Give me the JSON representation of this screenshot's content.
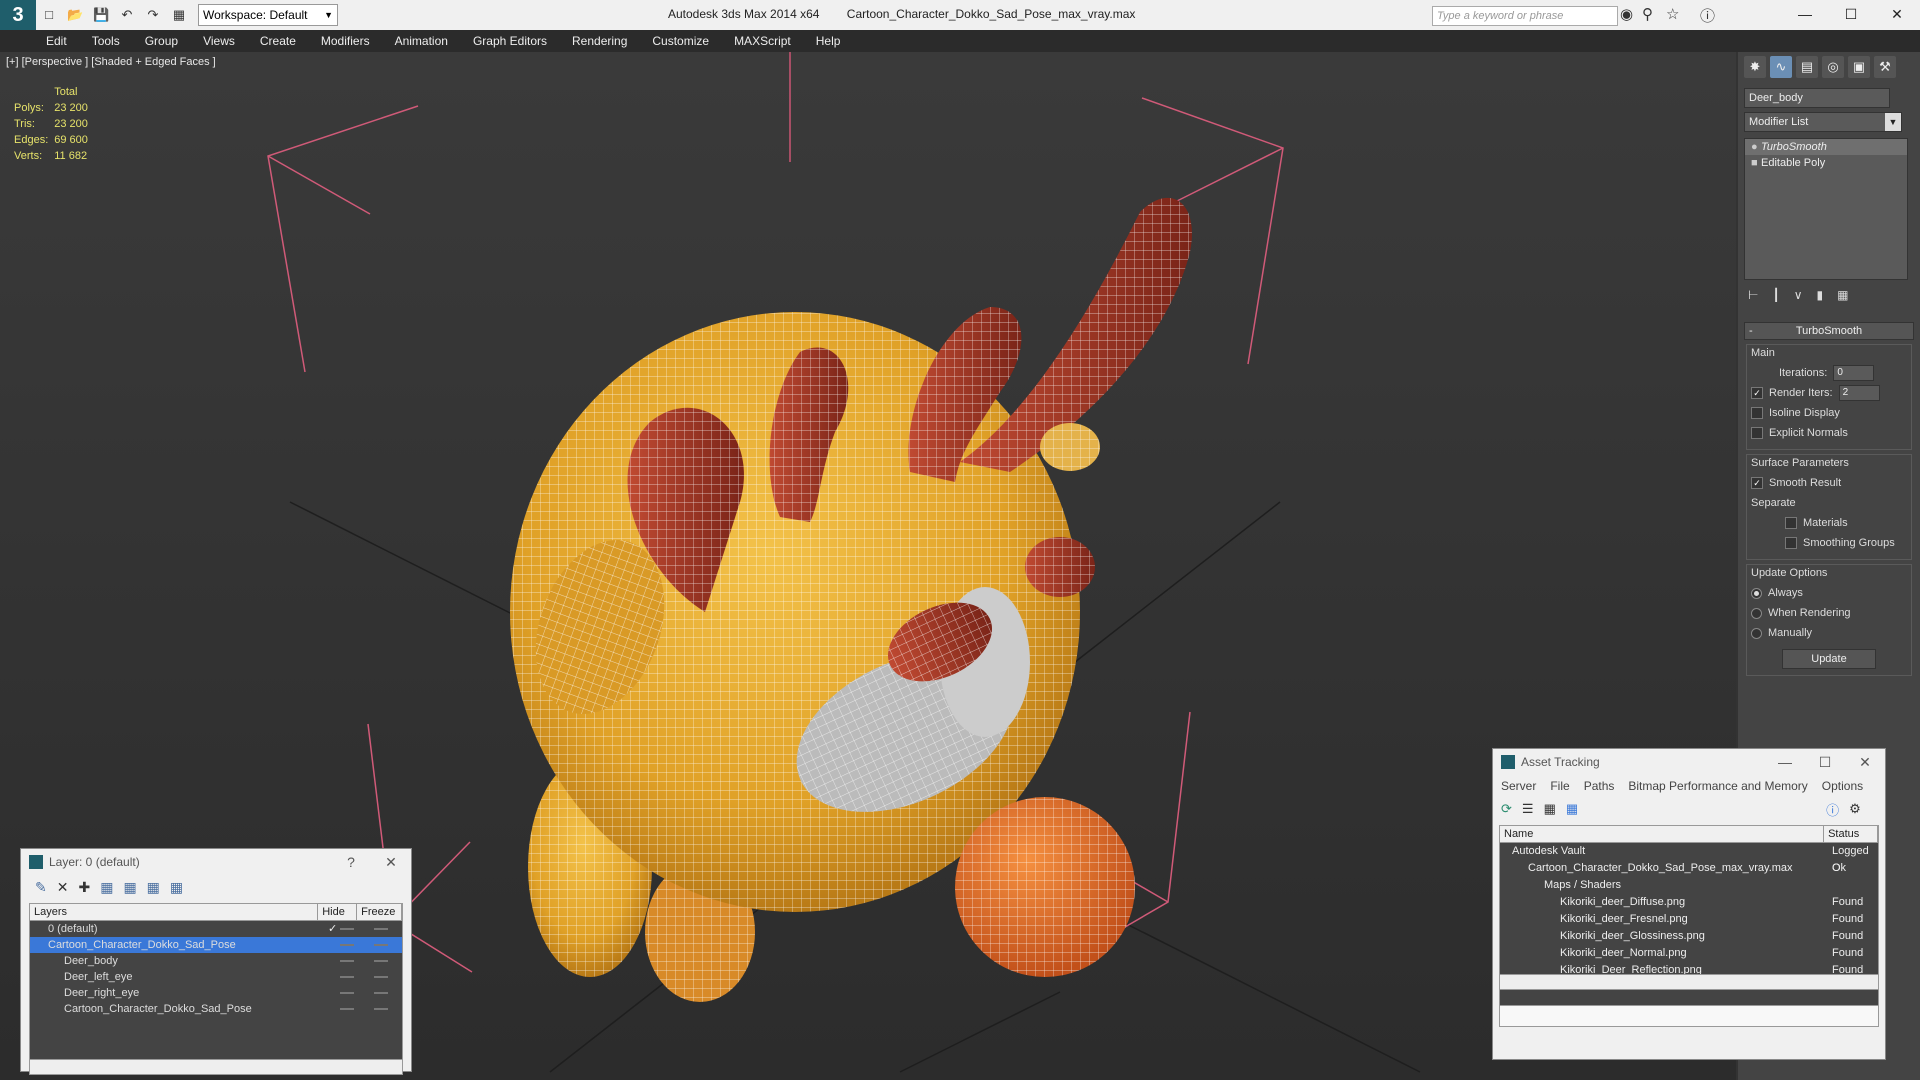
{
  "app": {
    "title": "Autodesk 3ds Max  2014 x64",
    "file": "Cartoon_Character_Dokko_Sad_Pose_max_vray.max",
    "workspace": "Workspace: Default",
    "search_placeholder": "Type a keyword or phrase",
    "logo": "3"
  },
  "menu": [
    "Edit",
    "Tools",
    "Group",
    "Views",
    "Create",
    "Modifiers",
    "Animation",
    "Graph Editors",
    "Rendering",
    "Customize",
    "MAXScript",
    "Help"
  ],
  "viewport": {
    "label": "[+] [Perspective ] [Shaded + Edged Faces ]",
    "stats_header": "Total",
    "stats": [
      {
        "label": "Polys:",
        "value": "23 200"
      },
      {
        "label": "Tris:",
        "value": "23 200"
      },
      {
        "label": "Edges:",
        "value": "69 600"
      },
      {
        "label": "Verts:",
        "value": "11 682"
      }
    ]
  },
  "command_panel": {
    "object_name": "Deer_body",
    "modifier_list": "Modifier List",
    "stack": [
      {
        "label": "TurboSmooth",
        "selected": true
      },
      {
        "label": "Editable Poly",
        "selected": false
      }
    ],
    "rollout": "TurboSmooth",
    "main_group": "Main",
    "iterations_label": "Iterations:",
    "iterations_value": "0",
    "render_iters_label": "Render Iters:",
    "render_iters_value": "2",
    "isoline": "Isoline Display",
    "explicit_normals": "Explicit Normals",
    "surface_group": "Surface Parameters",
    "smooth_result": "Smooth Result",
    "separate": "Separate",
    "materials": "Materials",
    "smoothing_groups": "Smoothing Groups",
    "update_group": "Update Options",
    "always": "Always",
    "when_rendering": "When Rendering",
    "manually": "Manually",
    "update_button": "Update"
  },
  "layer_window": {
    "title": "Layer: 0 (default)",
    "help": "?",
    "col_layers": "Layers",
    "col_hide": "Hide",
    "col_freeze": "Freeze",
    "rows": [
      {
        "name": "0 (default)",
        "indent": 0,
        "selected": false
      },
      {
        "name": "Cartoon_Character_Dokko_Sad_Pose",
        "indent": 0,
        "selected": true
      },
      {
        "name": "Deer_body",
        "indent": 1,
        "selected": false
      },
      {
        "name": "Deer_left_eye",
        "indent": 1,
        "selected": false
      },
      {
        "name": "Deer_right_eye",
        "indent": 1,
        "selected": false
      },
      {
        "name": "Cartoon_Character_Dokko_Sad_Pose",
        "indent": 1,
        "selected": false
      }
    ]
  },
  "asset_window": {
    "title": "Asset Tracking",
    "menu": [
      "Server",
      "File",
      "Paths",
      "Bitmap Performance and Memory",
      "Options"
    ],
    "col_name": "Name",
    "col_status": "Status",
    "rows": [
      {
        "name": "Autodesk Vault",
        "status": "Logged O",
        "indent": 0
      },
      {
        "name": "Cartoon_Character_Dokko_Sad_Pose_max_vray.max",
        "status": "Ok",
        "indent": 1
      },
      {
        "name": "Maps / Shaders",
        "status": "",
        "indent": 2
      },
      {
        "name": "Kikoriki_deer_Diffuse.png",
        "status": "Found",
        "indent": 3
      },
      {
        "name": "Kikoriki_deer_Fresnel.png",
        "status": "Found",
        "indent": 3
      },
      {
        "name": "Kikoriki_deer_Glossiness.png",
        "status": "Found",
        "indent": 3
      },
      {
        "name": "Kikoriki_deer_Normal.png",
        "status": "Found",
        "indent": 3
      },
      {
        "name": "Kikoriki_Deer_Reflection.png",
        "status": "Found",
        "indent": 3
      }
    ]
  },
  "colors": {
    "body": "#e8b030",
    "antler": "#a83a2a",
    "nose": "#e06a20",
    "bracket": "#d05a78",
    "selection": "#3a78d8"
  }
}
